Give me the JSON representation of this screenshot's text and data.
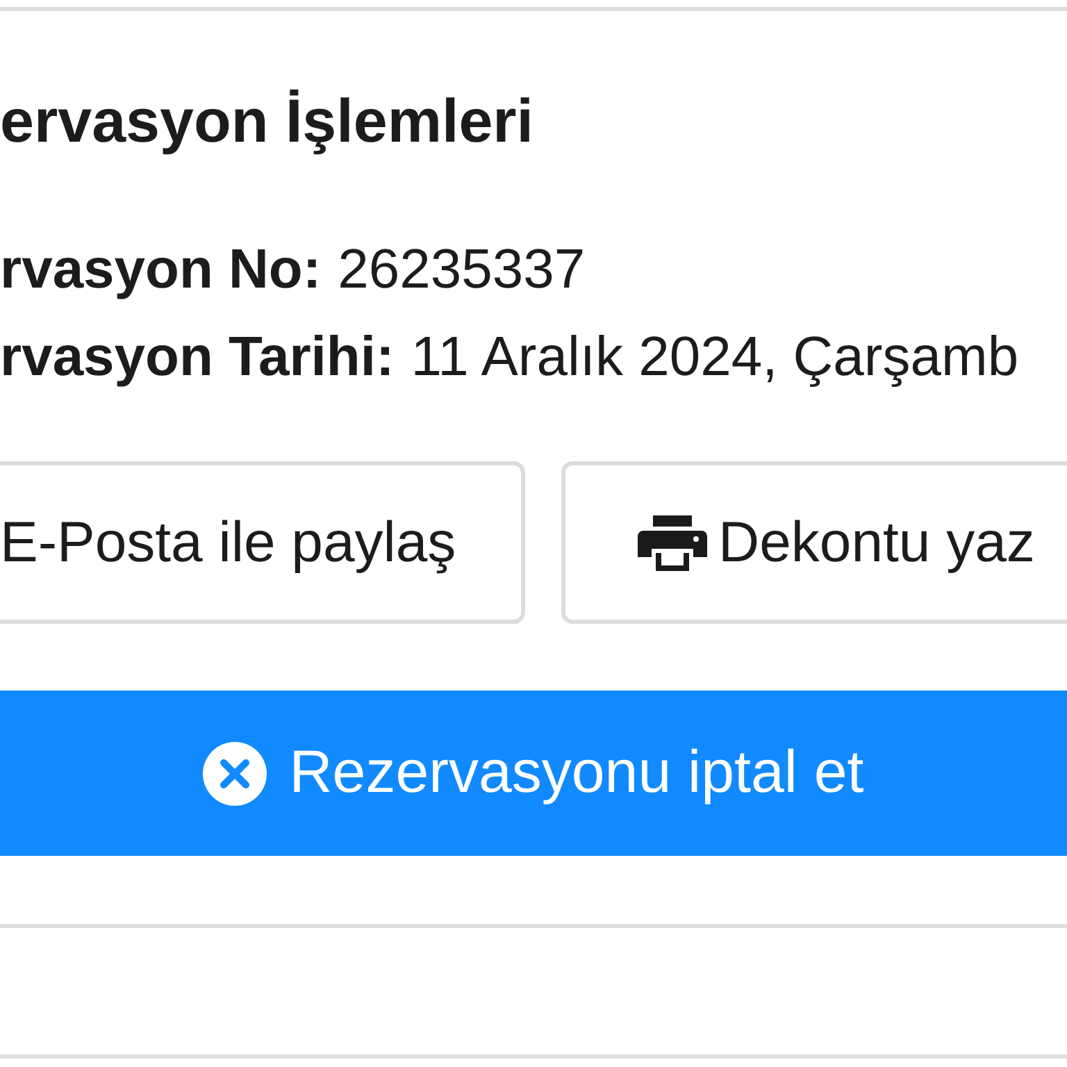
{
  "section": {
    "title": "ervasyon İşlemleri",
    "details": [
      {
        "label": "rvasyon No:",
        "value": "26235337"
      },
      {
        "label": "rvasyon Tarihi:",
        "value": "11 Aralık 2024, Çarşamb"
      }
    ],
    "actions": [
      {
        "kind": "share",
        "label": "E-Posta ile paylaş"
      },
      {
        "kind": "print",
        "label": "Dekontu yaz"
      }
    ],
    "cancel_button": {
      "label": "Rezervasyonu iptal et"
    }
  }
}
